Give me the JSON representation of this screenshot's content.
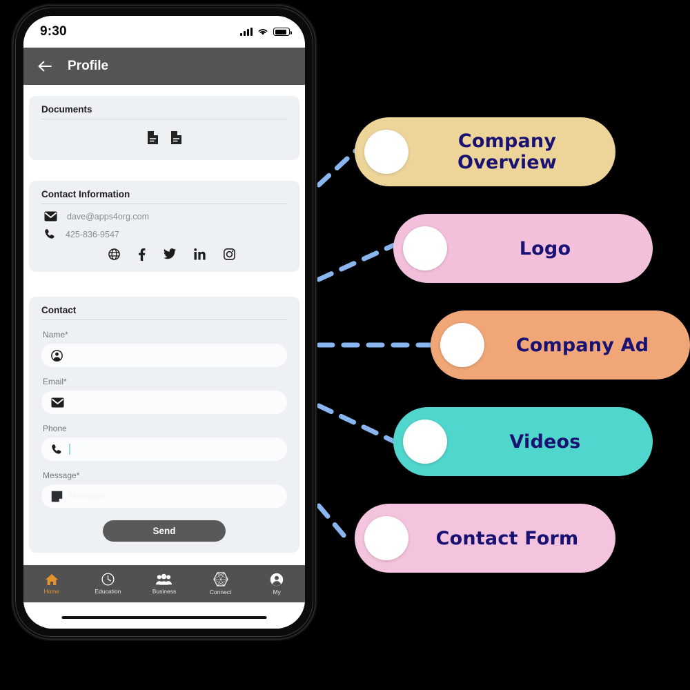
{
  "phone": {
    "status_bar": {
      "clock": "9:30",
      "signal_icon": "cellular-signal-icon",
      "wifi_icon": "wifi-icon",
      "battery_icon": "battery-icon"
    },
    "app_bar": {
      "back_icon": "back-arrow-icon",
      "title": "Profile"
    },
    "documents_card": {
      "title": "Documents",
      "items": [
        {
          "icon": "document-icon"
        },
        {
          "icon": "document-icon"
        }
      ]
    },
    "contact_info_card": {
      "title": "Contact Information",
      "email": {
        "icon": "envelope-icon",
        "value": "dave@apps4org.com"
      },
      "phone": {
        "icon": "phone-icon",
        "value": "425-836-9547"
      },
      "social": [
        {
          "icon": "globe-icon",
          "name": "website"
        },
        {
          "icon": "facebook-icon",
          "name": "facebook"
        },
        {
          "icon": "twitter-icon",
          "name": "twitter"
        },
        {
          "icon": "linkedin-icon",
          "name": "linkedin"
        },
        {
          "icon": "instagram-icon",
          "name": "instagram"
        }
      ]
    },
    "contact_form_card": {
      "title": "Contact",
      "fields": [
        {
          "label": "Name*",
          "icon": "person-icon",
          "value": "",
          "placeholder": ""
        },
        {
          "label": "Email*",
          "icon": "envelope-icon",
          "value": "",
          "placeholder": ""
        },
        {
          "label": "Phone",
          "icon": "phone-icon",
          "value": "",
          "placeholder": "",
          "focused": true
        },
        {
          "label": "Message*",
          "icon": "note-icon",
          "value": "",
          "placeholder": "Message"
        }
      ],
      "send_label": "Send"
    },
    "bottom_nav": [
      {
        "label": "Home",
        "icon": "home-icon",
        "active": true
      },
      {
        "label": "Education",
        "icon": "clock-icon",
        "active": false
      },
      {
        "label": "Business",
        "icon": "people-icon",
        "active": false
      },
      {
        "label": "Connect",
        "icon": "hexagon-icon",
        "active": false
      },
      {
        "label": "My",
        "icon": "account-icon",
        "active": false
      }
    ]
  },
  "callouts": [
    {
      "label": "Company Overview",
      "color": "#edd59a",
      "text_color": "#1a1272"
    },
    {
      "label": "Logo",
      "color": "#f3c0dc",
      "text_color": "#1a1272"
    },
    {
      "label": "Company Ad",
      "color": "#f0a677",
      "text_color": "#1a1272"
    },
    {
      "label": "Videos",
      "color": "#51d6ce",
      "text_color": "#1a1272"
    },
    {
      "label": "Contact Form",
      "color": "#f4c3dd",
      "text_color": "#1a1272"
    }
  ],
  "connector_color": "#8ab6f0"
}
